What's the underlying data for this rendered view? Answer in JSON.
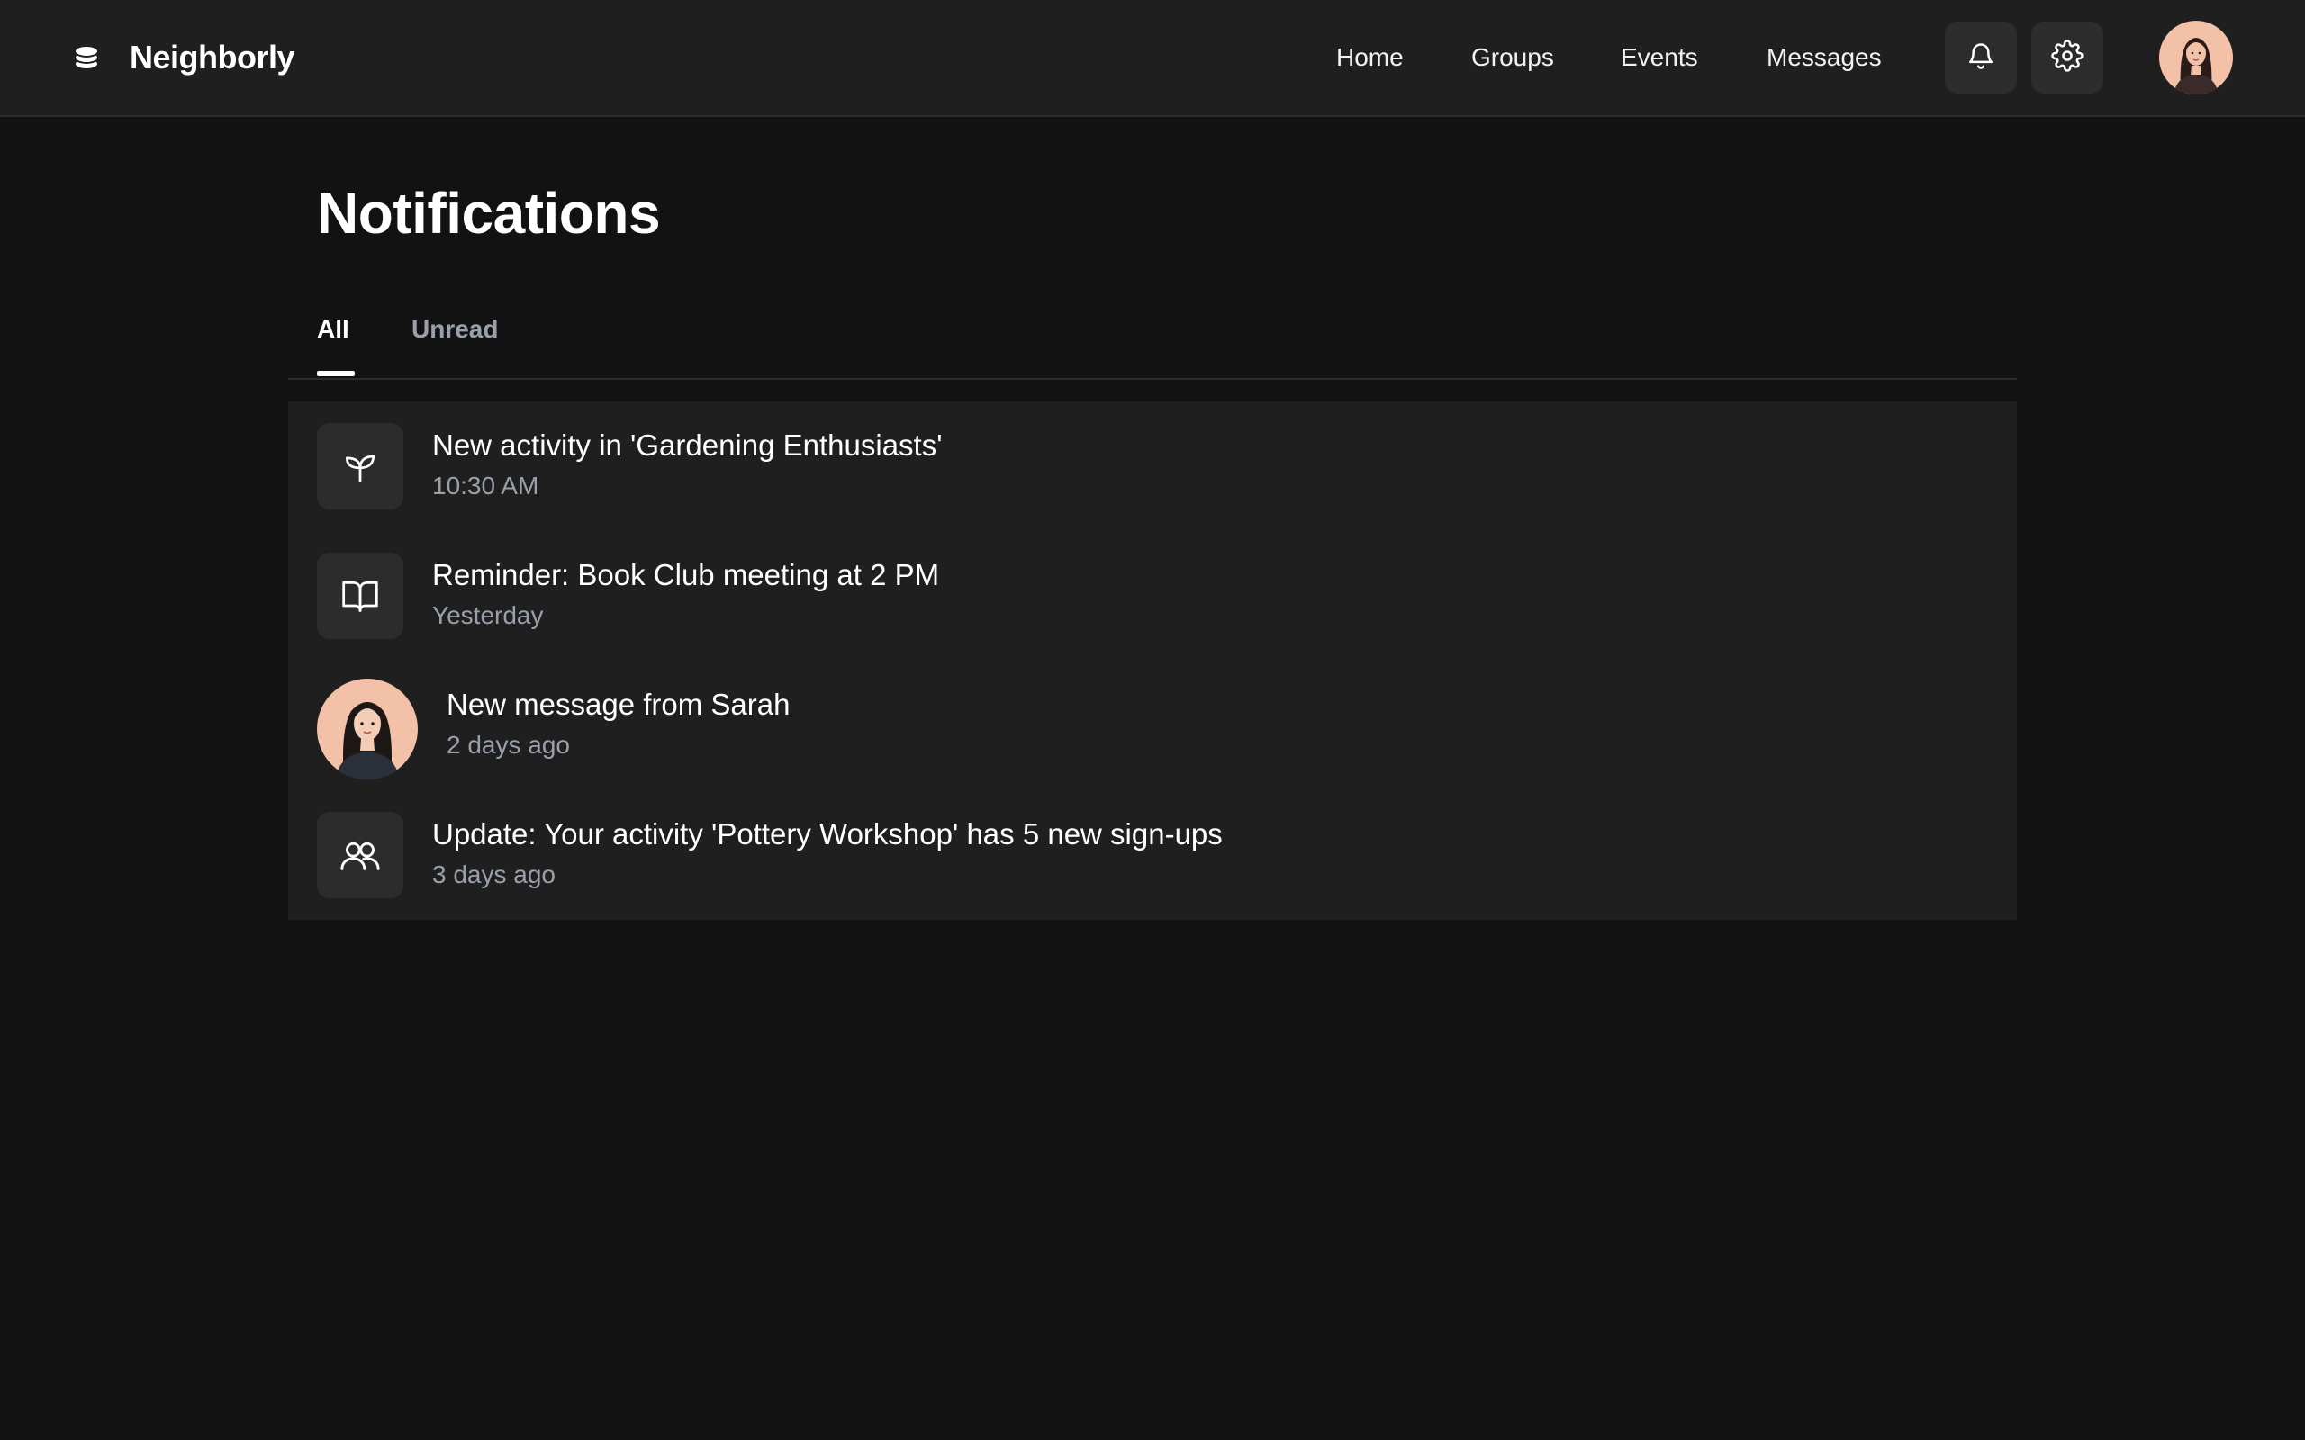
{
  "app": {
    "name": "Neighborly",
    "logo_icon": "stack-logo-icon"
  },
  "nav": {
    "items": [
      {
        "label": "Home"
      },
      {
        "label": "Groups"
      },
      {
        "label": "Events"
      },
      {
        "label": "Messages"
      }
    ],
    "notifications_icon": "bell-icon",
    "settings_icon": "gear-icon",
    "profile_avatar": "user-avatar"
  },
  "page": {
    "title": "Notifications",
    "tabs": [
      {
        "label": "All",
        "active": true
      },
      {
        "label": "Unread",
        "active": false
      }
    ]
  },
  "notifications": [
    {
      "icon": "sprout-icon",
      "title": "New activity in 'Gardening Enthusiasts'",
      "time": "10:30 AM"
    },
    {
      "icon": "book-open-icon",
      "title": "Reminder: Book Club meeting at 2 PM",
      "time": "Yesterday"
    },
    {
      "icon": "sarah-avatar",
      "title": "New message from Sarah",
      "time": "2 days ago"
    },
    {
      "icon": "users-icon",
      "title": "Update: Your activity 'Pottery Workshop' has 5 new sign-ups",
      "time": "3 days ago"
    }
  ],
  "colors": {
    "background": "#121212",
    "surface": "#1f1f1f",
    "icon_tile": "#2c2c2c",
    "muted_text": "#9aa0aa",
    "avatar_bg": "#f3c0a8"
  }
}
